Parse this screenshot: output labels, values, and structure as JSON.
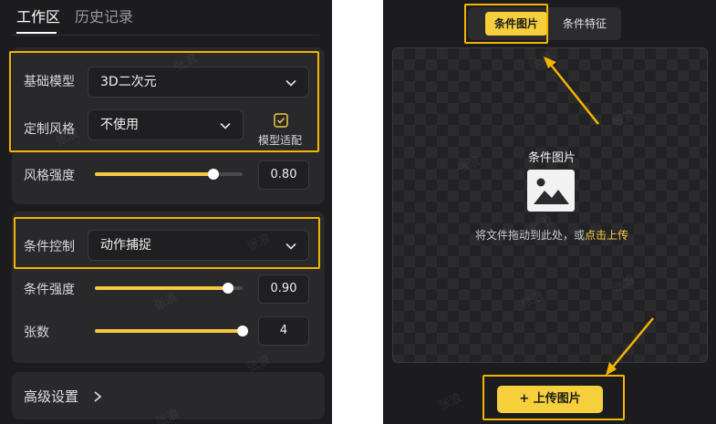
{
  "left": {
    "tabs": [
      {
        "label": "工作区",
        "active": true
      },
      {
        "label": "历史记录",
        "active": false
      }
    ],
    "base_model": {
      "label": "基础模型",
      "value": "3D二次元"
    },
    "custom_style": {
      "label": "定制风格",
      "value": "不使用",
      "checkbox_label": "模型适配"
    },
    "style_strength": {
      "label": "风格强度",
      "value": "0.80",
      "fraction": 0.8
    },
    "condition_control": {
      "label": "条件控制",
      "value": "动作捕捉"
    },
    "condition_strength": {
      "label": "条件强度",
      "value": "0.90",
      "fraction": 0.9
    },
    "count": {
      "label": "张数",
      "value": "4",
      "fraction": 1.0
    },
    "advanced": {
      "label": "高级设置"
    }
  },
  "right": {
    "segments": [
      {
        "label": "条件图片",
        "active": true
      },
      {
        "label": "条件特征",
        "active": false
      }
    ],
    "drop_zone": {
      "title": "条件图片",
      "hint_prefix": "将文件拖动到此处，或",
      "hint_link": "点击上传"
    },
    "upload_button": {
      "label": "上传图片"
    }
  },
  "watermark": "张浪",
  "colors": {
    "accent": "#f5cf3c",
    "highlight": "#f5b400",
    "panel": "#1c1c1e",
    "card": "#29292c"
  },
  "icons": {
    "select_chevron": "chevron-down-icon",
    "advanced_chevron": "chevron-right-icon",
    "drop_image": "image-icon",
    "upload_plus": "plus-icon",
    "fit_checkbox": "checkbox-checked-icon"
  }
}
